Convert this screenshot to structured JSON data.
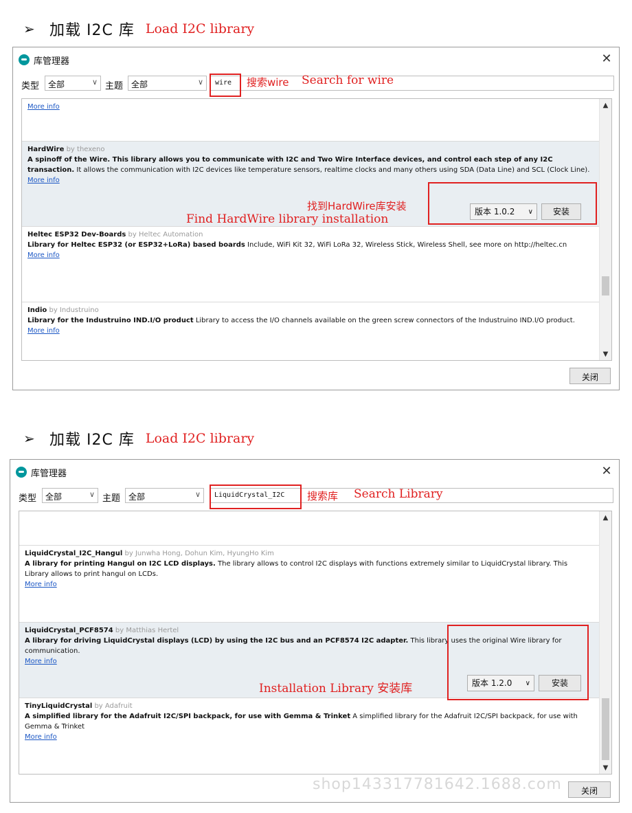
{
  "sections": [
    {
      "heading": {
        "arrow": "➢",
        "zh": "加载 I2C 库",
        "en": "Load I2C library"
      },
      "window": {
        "title": "库管理器",
        "close": "✕",
        "type_label": "类型",
        "type_value": "全部",
        "topic_label": "主题",
        "topic_value": "全部",
        "search_value": "wire",
        "annot_zh": "搜索wire",
        "annot_en": "Search for wire",
        "top_more": "More info",
        "entries": [
          {
            "name": "HardWire",
            "by": "by thexeno",
            "bold": "A spinoff of the Wire. This library allows you to communicate with I2C and Two Wire Interface devices, and control each step of any I2C transaction.",
            "desc": " It allows the communication with I2C devices like temperature sensors, realtime clocks and many others using SDA (Data Line) and SCL (Clock Line).",
            "more": "More info"
          },
          {
            "name": "Heltec ESP32 Dev-Boards",
            "by": "by Heltec Automation",
            "bold": "Library for Heltec ESP32 (or ESP32+LoRa) based boards",
            "desc": " Include, WiFi Kit 32, WiFi LoRa 32, Wireless Stick, Wireless Shell, see more on http://heltec.cn",
            "more": "More info"
          },
          {
            "name": "Indio",
            "by": "by Industruino",
            "bold": "Library for the Industruino IND.I/O product",
            "desc": " Library to access the I/O channels available on the green screw connectors of the Industruino IND.I/O product.",
            "more": "More info"
          }
        ],
        "version": "版本 1.0.2",
        "install": "安装",
        "annot2_zh": "找到HardWire库安装",
        "annot2_en": "Find HardWire library installation",
        "close_button": "关闭"
      }
    },
    {
      "heading": {
        "arrow": "➢",
        "zh": "加载 I2C 库",
        "en": "Load I2C library"
      },
      "window": {
        "title": "库管理器",
        "close": "✕",
        "type_label": "类型",
        "type_value": "全部",
        "topic_label": "主题",
        "topic_value": "全部",
        "search_value": "LiquidCrystal_I2C",
        "annot_zh": "搜索库",
        "annot_en": "Search Library",
        "entries": [
          {
            "name": "LiquidCrystal_I2C_Hangul",
            "by": "by Junwha Hong, Dohun Kim, HyungHo Kim",
            "bold": "A library for printing Hangul on I2C LCD displays.",
            "desc": " The library allows to control I2C displays with functions extremely similar to LiquidCrystal library. This Library allows to print hangul on LCDs.",
            "more": "More info"
          },
          {
            "name": "LiquidCrystal_PCF8574",
            "by": "by Matthias Hertel",
            "bold": "A library for driving LiquidCrystal displays (LCD) by using the I2C bus and an PCF8574 I2C adapter.",
            "desc": " This library uses the original Wire library for communication.",
            "more": "More info"
          },
          {
            "name": "TinyLiquidCrystal",
            "by": "by Adafruit",
            "bold": "A simplified library for the Adafruit I2C/SPI backpack, for use with Gemma & Trinket",
            "desc": " A simplified library for the Adafruit I2C/SPI backpack, for use with Gemma & Trinket",
            "more": "More info"
          }
        ],
        "version": "版本 1.2.0",
        "install": "安装",
        "annot2": "Installation Library 安装库",
        "close_button": "关闭",
        "watermark": "shop143317781642.1688.com"
      }
    }
  ]
}
